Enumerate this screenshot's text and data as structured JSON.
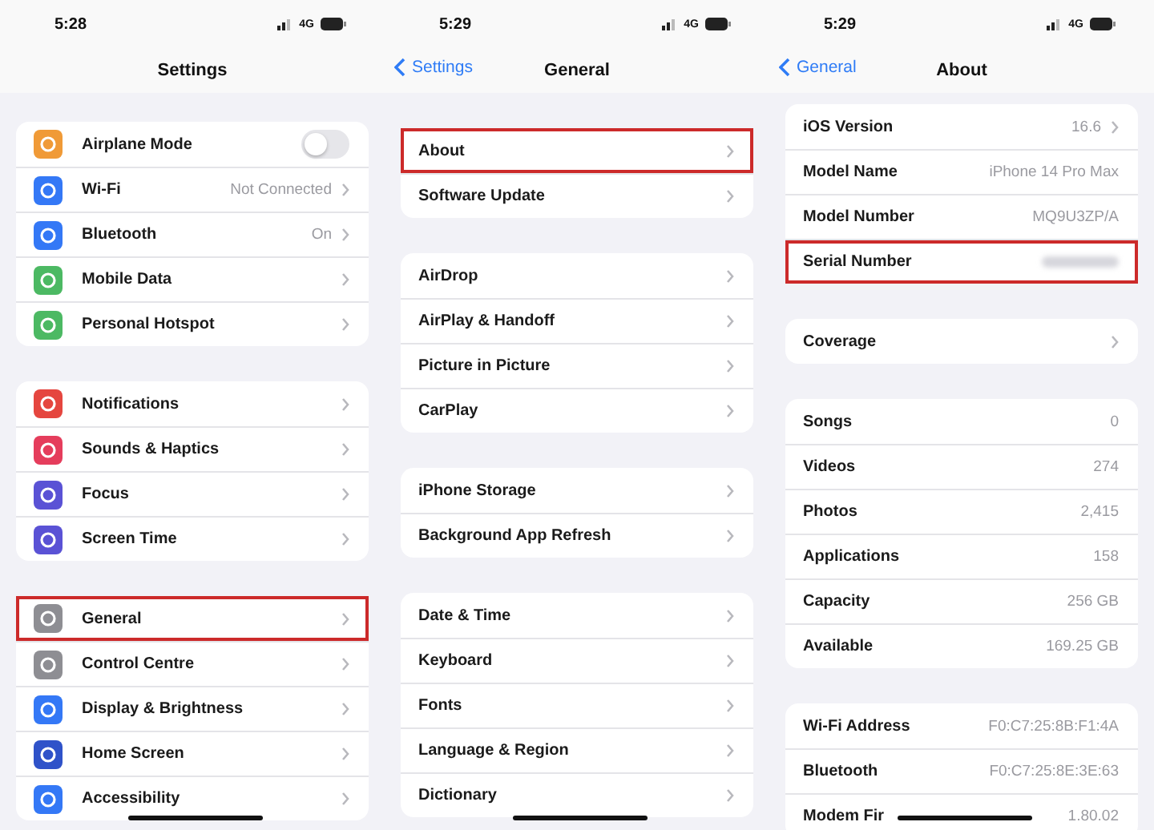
{
  "panels": [
    {
      "status": {
        "time": "5:28",
        "network": "4G"
      },
      "nav": {
        "title": "Settings"
      },
      "groups": [
        {
          "rows": [
            {
              "label": "Airplane Mode",
              "color": "#f09a37",
              "kind": "toggle",
              "on": false,
              "chevron": false,
              "highlighted": false
            },
            {
              "label": "Wi-Fi",
              "color": "#3478f6",
              "value": "Not Connected",
              "chevron": true,
              "highlighted": false
            },
            {
              "label": "Bluetooth",
              "color": "#3478f6",
              "value": "On",
              "chevron": true,
              "highlighted": false
            },
            {
              "label": "Mobile Data",
              "color": "#4cb963",
              "chevron": true,
              "highlighted": false
            },
            {
              "label": "Personal Hotspot",
              "color": "#4cb963",
              "chevron": true,
              "highlighted": false
            }
          ]
        },
        {
          "rows": [
            {
              "label": "Notifications",
              "color": "#e5463f",
              "chevron": true,
              "highlighted": false
            },
            {
              "label": "Sounds & Haptics",
              "color": "#e53d5c",
              "chevron": true,
              "highlighted": false
            },
            {
              "label": "Focus",
              "color": "#5a52d5",
              "chevron": true,
              "highlighted": false
            },
            {
              "label": "Screen Time",
              "color": "#5a52d5",
              "chevron": true,
              "highlighted": false
            }
          ]
        },
        {
          "rows": [
            {
              "label": "General",
              "color": "#8e8e93",
              "chevron": true,
              "highlighted": true
            },
            {
              "label": "Control Centre",
              "color": "#8e8e93",
              "chevron": true,
              "highlighted": false
            },
            {
              "label": "Display & Brightness",
              "color": "#3478f6",
              "chevron": true,
              "highlighted": false
            },
            {
              "label": "Home Screen",
              "color": "#2f52c9",
              "chevron": true,
              "highlighted": false
            },
            {
              "label": "Accessibility",
              "color": "#3478f6",
              "chevron": true,
              "highlighted": false
            }
          ]
        }
      ]
    },
    {
      "status": {
        "time": "5:29",
        "network": "4G"
      },
      "nav": {
        "back": "Settings",
        "title": "General"
      },
      "groups": [
        {
          "rows": [
            {
              "label": "About",
              "chevron": true,
              "highlighted": true
            },
            {
              "label": "Software Update",
              "chevron": true,
              "highlighted": false
            }
          ]
        },
        {
          "rows": [
            {
              "label": "AirDrop",
              "chevron": true,
              "highlighted": false
            },
            {
              "label": "AirPlay & Handoff",
              "chevron": true,
              "highlighted": false
            },
            {
              "label": "Picture in Picture",
              "chevron": true,
              "highlighted": false
            },
            {
              "label": "CarPlay",
              "chevron": true,
              "highlighted": false
            }
          ]
        },
        {
          "rows": [
            {
              "label": "iPhone Storage",
              "chevron": true,
              "highlighted": false
            },
            {
              "label": "Background App Refresh",
              "chevron": true,
              "highlighted": false
            }
          ]
        },
        {
          "rows": [
            {
              "label": "Date & Time",
              "chevron": true,
              "highlighted": false
            },
            {
              "label": "Keyboard",
              "chevron": true,
              "highlighted": false
            },
            {
              "label": "Fonts",
              "chevron": true,
              "highlighted": false
            },
            {
              "label": "Language & Region",
              "chevron": true,
              "highlighted": false
            },
            {
              "label": "Dictionary",
              "chevron": true,
              "highlighted": false
            }
          ]
        }
      ]
    },
    {
      "status": {
        "time": "5:29",
        "network": "4G"
      },
      "nav": {
        "back": "General",
        "title": "About"
      },
      "groups": [
        {
          "rows": [
            {
              "label": "iOS Version",
              "value": "16.6",
              "chevron": true,
              "highlighted": false
            },
            {
              "label": "Model Name",
              "value": "iPhone 14 Pro Max",
              "chevron": false,
              "highlighted": false
            },
            {
              "label": "Model Number",
              "value": "MQ9U3ZP/A",
              "chevron": false,
              "highlighted": false
            },
            {
              "label": "Serial Number",
              "value_blurred": true,
              "chevron": false,
              "highlighted": true
            }
          ]
        },
        {
          "rows": [
            {
              "label": "Coverage",
              "chevron": true,
              "highlighted": false
            }
          ]
        },
        {
          "rows": [
            {
              "label": "Songs",
              "value": "0",
              "chevron": false,
              "highlighted": false
            },
            {
              "label": "Videos",
              "value": "274",
              "chevron": false,
              "highlighted": false
            },
            {
              "label": "Photos",
              "value": "2,415",
              "chevron": false,
              "highlighted": false
            },
            {
              "label": "Applications",
              "value": "158",
              "chevron": false,
              "highlighted": false
            },
            {
              "label": "Capacity",
              "value": "256 GB",
              "chevron": false,
              "highlighted": false
            },
            {
              "label": "Available",
              "value": "169.25 GB",
              "chevron": false,
              "highlighted": false
            }
          ]
        },
        {
          "rows": [
            {
              "label": "Wi-Fi Address",
              "value": "F0:C7:25:8B:F1:4A",
              "chevron": false,
              "highlighted": false
            },
            {
              "label": "Bluetooth",
              "value": "F0:C7:25:8E:3E:63",
              "chevron": false,
              "highlighted": false
            },
            {
              "label": "Modem Fir",
              "value": "1.80.02",
              "chevron": false,
              "highlighted": false
            }
          ]
        }
      ]
    }
  ]
}
